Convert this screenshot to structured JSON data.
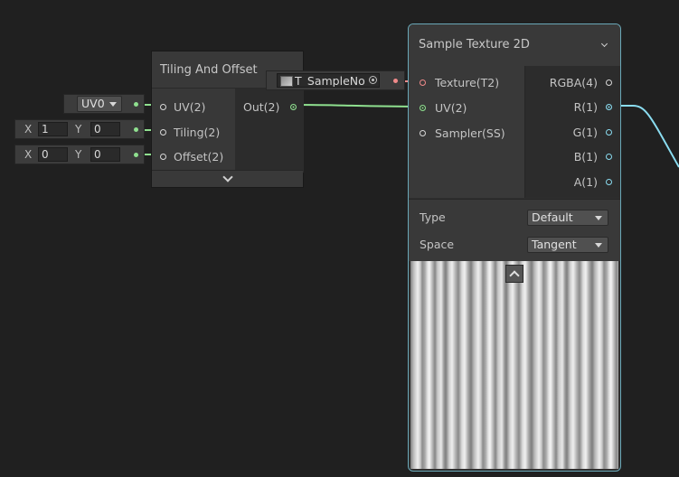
{
  "tiling_node": {
    "title": "Tiling And Offset",
    "inputs": [
      {
        "label": "UV(2)"
      },
      {
        "label": "Tiling(2)"
      },
      {
        "label": "Offset(2)"
      }
    ],
    "output": {
      "label": "Out(2)"
    },
    "uv_channel": "UV0",
    "tiling": {
      "x_label": "X",
      "x": "1",
      "y_label": "Y",
      "y": "0"
    },
    "offset": {
      "x_label": "X",
      "x": "0",
      "y_label": "Y",
      "y": "0"
    }
  },
  "texture_field": {
    "value": "T_SampleNo"
  },
  "sample_node": {
    "title": "Sample Texture 2D",
    "inputs": [
      {
        "label": "Texture(T2)"
      },
      {
        "label": "UV(2)"
      },
      {
        "label": "Sampler(SS)"
      }
    ],
    "outputs": [
      {
        "label": "RGBA(4)"
      },
      {
        "label": "R(1)"
      },
      {
        "label": "G(1)"
      },
      {
        "label": "B(1)"
      },
      {
        "label": "A(1)"
      }
    ],
    "type_label": "Type",
    "type_value": "Default",
    "space_label": "Space",
    "space_value": "Tangent"
  },
  "colors": {
    "background": "#202020",
    "node_body": "#393939",
    "vector2_wire": "#8fe08f",
    "float_wire": "#8adcf0",
    "texture_port": "#f08a8a",
    "selection_outline": "#6aa8b8"
  }
}
